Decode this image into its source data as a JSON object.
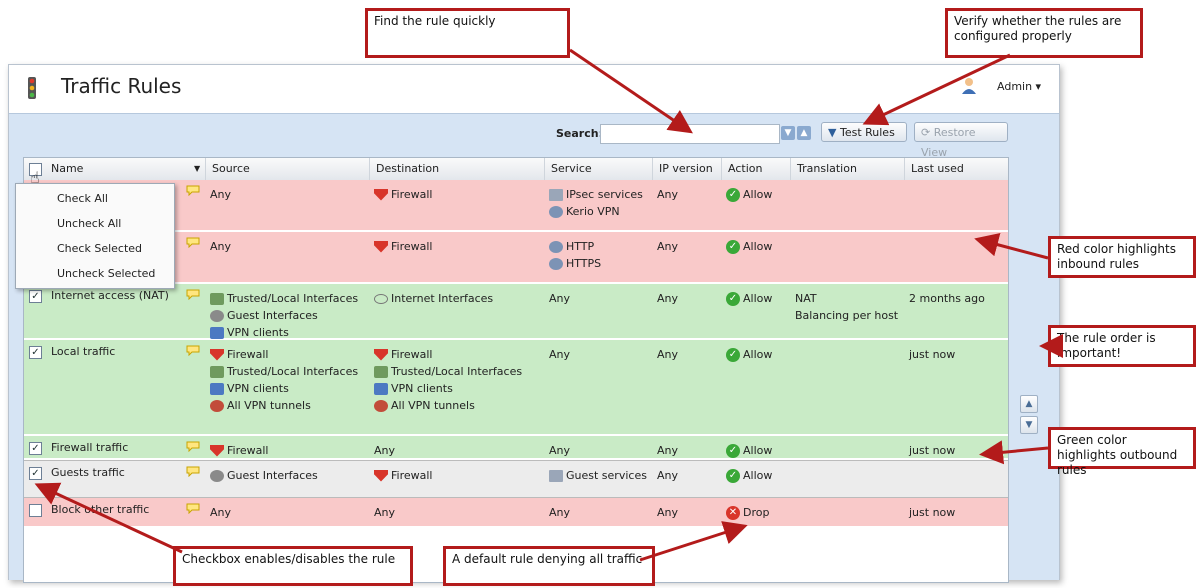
{
  "app": {
    "title": "Traffic Rules",
    "user": "Admin ▾"
  },
  "toolbar": {
    "search_label": "Search:",
    "search_value": "",
    "search_placeholder": "",
    "test_rules_label": "Test Rules",
    "restore_view_label": "Restore View"
  },
  "columns": [
    "Name",
    "Source",
    "Destination",
    "Service",
    "IP version",
    "Action",
    "Translation",
    "Last used"
  ],
  "context_menu": [
    "Check All",
    "Uncheck All",
    "Check Selected",
    "Uncheck Selected"
  ],
  "rows": [
    {
      "name": "",
      "checked": false,
      "color": "red",
      "source": [
        "Any"
      ],
      "destination": [
        "Firewall"
      ],
      "service": [
        "IPsec services",
        "Kerio VPN"
      ],
      "ip": "Any",
      "action": "Allow",
      "translation": [],
      "last_used": ""
    },
    {
      "name": "",
      "checked": false,
      "color": "red",
      "source": [
        "Any"
      ],
      "destination": [
        "Firewall"
      ],
      "service": [
        "HTTP",
        "HTTPS"
      ],
      "ip": "Any",
      "action": "Allow",
      "translation": [],
      "last_used": ""
    },
    {
      "name": "Internet access (NAT)",
      "checked": true,
      "color": "green",
      "source": [
        "Trusted/Local Interfaces",
        "Guest Interfaces",
        "VPN clients"
      ],
      "destination": [
        "Internet Interfaces"
      ],
      "service": [
        "Any"
      ],
      "ip": "Any",
      "action": "Allow",
      "translation": [
        "NAT",
        "Balancing per host"
      ],
      "last_used": "2 months ago"
    },
    {
      "name": "Local traffic",
      "checked": true,
      "color": "green",
      "source": [
        "Firewall",
        "Trusted/Local Interfaces",
        "VPN clients",
        "All VPN tunnels"
      ],
      "destination": [
        "Firewall",
        "Trusted/Local Interfaces",
        "VPN clients",
        "All VPN tunnels"
      ],
      "service": [
        "Any"
      ],
      "ip": "Any",
      "action": "Allow",
      "translation": [],
      "last_used": "just now"
    },
    {
      "name": "Firewall traffic",
      "checked": true,
      "color": "green",
      "source": [
        "Firewall"
      ],
      "destination": [
        "Any"
      ],
      "service": [
        "Any"
      ],
      "ip": "Any",
      "action": "Allow",
      "translation": [],
      "last_used": "just now"
    },
    {
      "name": "Guests traffic",
      "checked": true,
      "color": "gray",
      "source": [
        "Guest Interfaces"
      ],
      "destination": [
        "Firewall"
      ],
      "service": [
        "Guest services"
      ],
      "ip": "Any",
      "action": "Allow",
      "translation": [],
      "last_used": ""
    },
    {
      "name": "Block other traffic",
      "checked": false,
      "color": "red",
      "source": [
        "Any"
      ],
      "destination": [
        "Any"
      ],
      "service": [
        "Any"
      ],
      "ip": "Any",
      "action": "Drop",
      "translation": [],
      "last_used": "just now"
    }
  ],
  "callouts": {
    "find": "Find the rule quickly",
    "verify": "Verify whether the rules are configured properly",
    "red": "Red color highlights inbound rules",
    "order": "The rule order is important!",
    "green": "Green color highlights outbound rules",
    "checkbox": "Checkbox enables/disables the rule",
    "default": "A default rule denying all traffic"
  },
  "colors": {
    "inbound_row": "#f9c9c9",
    "outbound_row": "#c9ebc6",
    "callout_border": "#b31b1b",
    "allow": "#3aa838",
    "drop": "#d9352a"
  }
}
